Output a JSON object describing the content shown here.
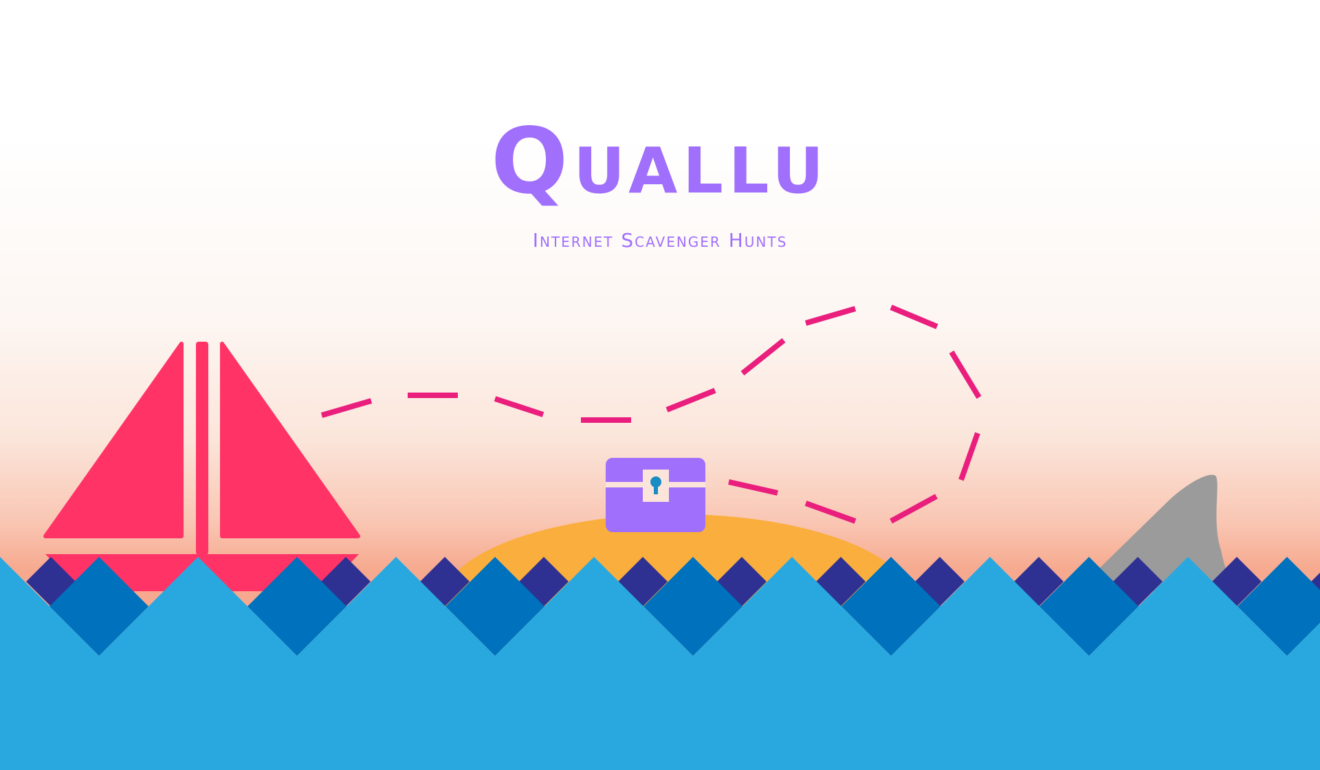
{
  "brand": {
    "title": "Quallu",
    "subtitle": "Internet Scavenger Hunts"
  },
  "colors": {
    "title": "#a06ffb",
    "sail": "#ff3366",
    "path": "#e91e7d",
    "chest": "#a06ffb",
    "keyhole": "#1a8cc4",
    "island": "#f9ae3d",
    "fin": "#9b9b9b",
    "wave_light": "#29a8e0",
    "wave_mid": "#0071bc",
    "wave_dark": "#2e3192"
  },
  "icons": {
    "boat": "sailboat-icon",
    "chest": "treasure-chest-icon",
    "fin": "shark-fin-icon"
  }
}
